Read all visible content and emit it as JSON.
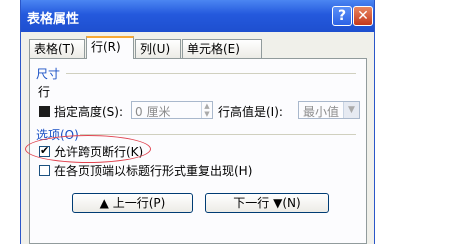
{
  "dialog": {
    "title": "表格属性",
    "help_glyph": "?",
    "close_glyph": "✕"
  },
  "tabs": [
    {
      "label": "表格(T)"
    },
    {
      "label": "行(R)"
    },
    {
      "label": "列(U)"
    },
    {
      "label": "单元格(E)"
    }
  ],
  "size_group": {
    "title": "尺寸",
    "row_label": "行",
    "specify_height_label": "指定高度(S):",
    "height_value": "0 厘米",
    "row_height_is_label": "行高值是(I):",
    "row_height_mode": "最小值"
  },
  "options_group": {
    "title": "选项(O)",
    "allow_break_label": "允许跨页断行(K)",
    "allow_break_checked": true,
    "repeat_header_label": "在各页顶端以标题行形式重复出现(H)",
    "repeat_header_checked": false
  },
  "buttons": {
    "prev_row": "▲ 上一行(P)",
    "next_row": "下一行 ▼(N)"
  }
}
